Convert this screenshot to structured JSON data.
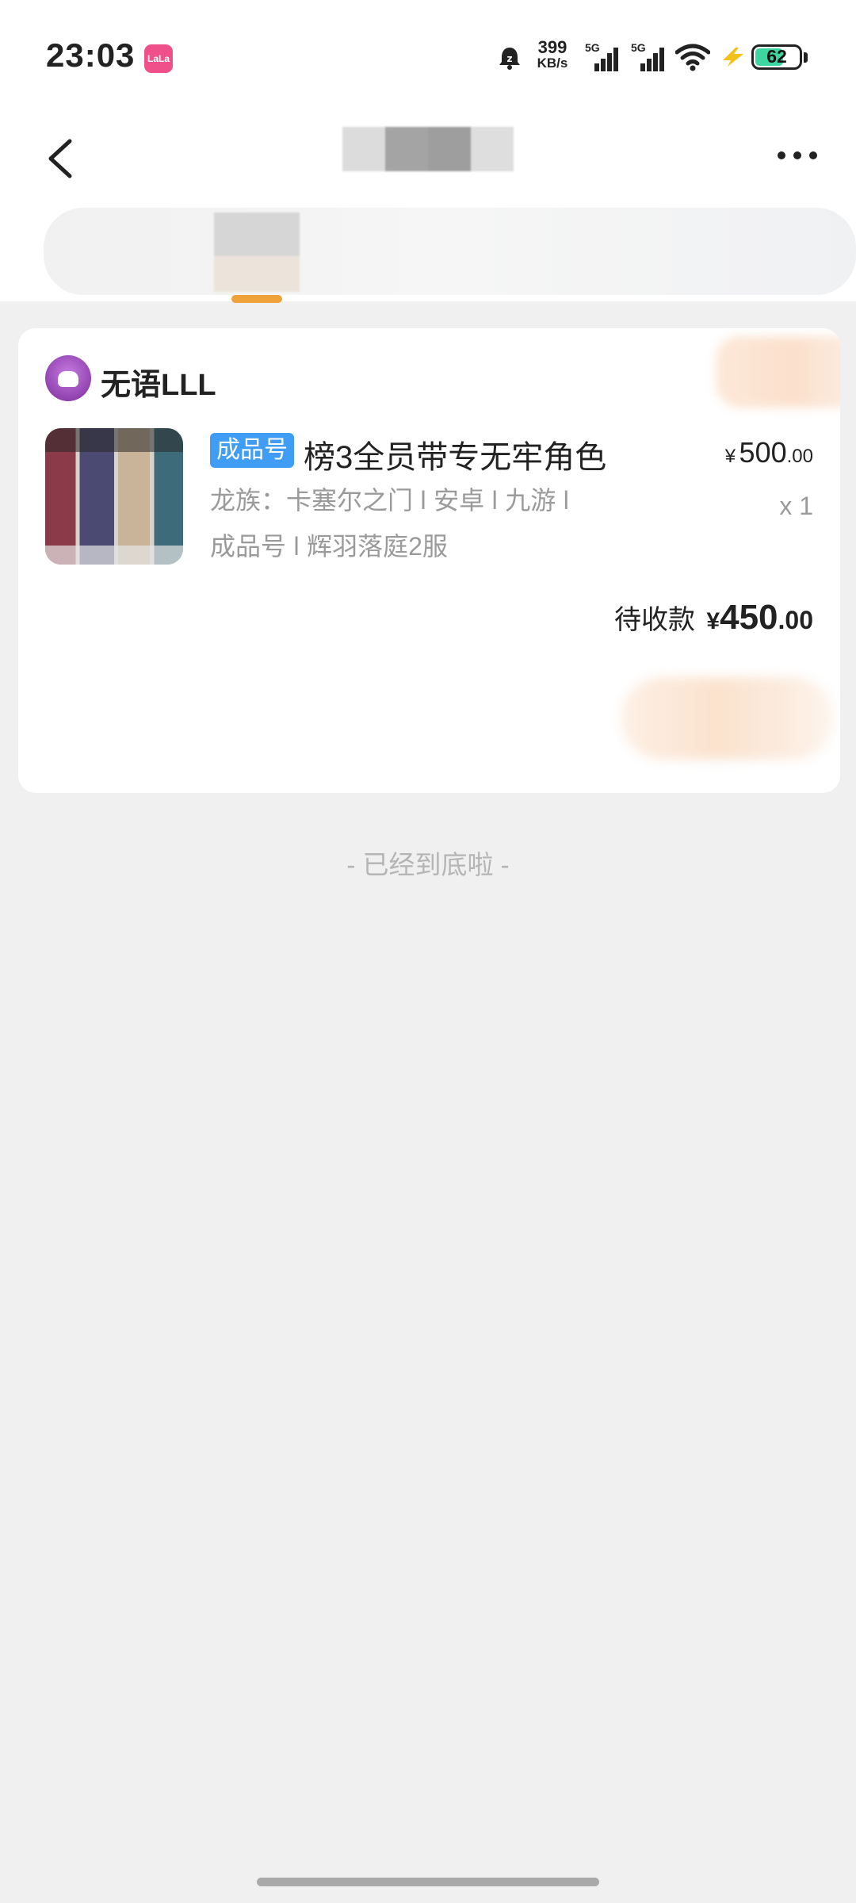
{
  "status_bar": {
    "time": "23:03",
    "app_badge": "LaLa",
    "net_speed_value": "399",
    "net_speed_unit": "KB/s",
    "sim1": "5G",
    "sim2": "5G",
    "battery": "62",
    "icons": [
      "alarm-icon",
      "signal-icon",
      "signal-icon",
      "wifi-icon",
      "charging-icon",
      "battery-icon"
    ]
  },
  "nav": {
    "back_icon": "chevron-left-icon",
    "more_icon": "more-dots-icon"
  },
  "order": {
    "seller_name": "无语LLL",
    "tag": "成品号",
    "title": "榜3全员带专无牢角色",
    "attrs_line1": "龙族：卡塞尔之门 ǀ 安卓 ǀ 九游 ǀ",
    "attrs_line2": "成品号 ǀ 辉羽落庭2服",
    "price_symbol": "¥",
    "price_int": "500",
    "price_dec": ".00",
    "quantity": "x 1",
    "pending_label": "待收款",
    "pending_symbol": "¥",
    "pending_int": "450",
    "pending_dec": ".00"
  },
  "footer": {
    "end_text": "- 已经到底啦 -"
  },
  "colors": {
    "accent_tab": "#f0a23a",
    "tag_bg": "#3f9df5",
    "battery_fill": "#3ed6a0",
    "page_bg": "#f0f0f0"
  }
}
